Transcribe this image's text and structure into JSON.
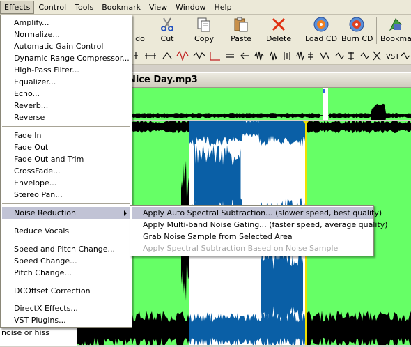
{
  "menubar": [
    "Effects",
    "Control",
    "Tools",
    "Bookmark",
    "View",
    "Window",
    "Help"
  ],
  "toolbar": {
    "undo": "do",
    "cut": "Cut",
    "copy": "Copy",
    "paste": "Paste",
    "delete": "Delete",
    "load_cd": "Load CD",
    "burn_cd": "Burn CD",
    "bookmark": "Bookmar"
  },
  "fxbar_vst": "VST",
  "file_title": "Nice Day.mp3",
  "left_panel_text": "noise or hiss",
  "effects_menu": {
    "group1": [
      "Amplify...",
      "Normalize...",
      "Automatic Gain Control",
      "Dynamic Range Compressor...",
      "High-Pass Filter...",
      "Equalizer...",
      "Echo...",
      "Reverb...",
      "Reverse"
    ],
    "group2": [
      "Fade In",
      "Fade Out",
      "Fade Out and Trim",
      "CrossFade...",
      "Envelope...",
      "Stereo Pan..."
    ],
    "noise_reduction": "Noise Reduction",
    "group4": [
      "Reduce Vocals"
    ],
    "group5": [
      "Speed and Pitch Change...",
      "Speed Change...",
      "Pitch Change..."
    ],
    "group6": [
      "DCOffset Correction"
    ],
    "group7": [
      "DirectX Effects...",
      "VST Plugins..."
    ]
  },
  "noise_reduction_menu": {
    "items": [
      "Apply Auto Spectral Subtraction... (slower speed, best quality)",
      "Apply Multi-band Noise Gating... (faster speed, average quality)",
      "Grab Noise Sample from Selected Area",
      "Apply Spectral Subtraction Based on Noise Sample"
    ],
    "disabled_index": 3
  },
  "colors": {
    "wave_bg": "#66ff66",
    "selection": "#ffffff",
    "selected_wave": "#0a5fa6",
    "marker": "#f0e000"
  }
}
